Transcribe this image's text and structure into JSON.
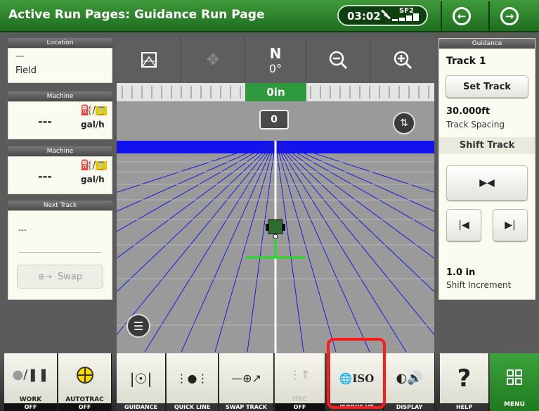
{
  "header": {
    "title": "Active Run Pages: Guidance Run Page",
    "clock": "03:02",
    "signal_label": "SF2"
  },
  "left_panel": {
    "location": {
      "header": "Location",
      "line1": "---",
      "line2": "Field"
    },
    "machine1": {
      "header": "Machine",
      "value": "---",
      "unit": "gal/h"
    },
    "machine2": {
      "header": "Machine",
      "value": "---",
      "unit": "gal/h"
    },
    "next_track": {
      "header": "Next Track",
      "value": "---",
      "swap_label": "Swap"
    }
  },
  "map": {
    "compass_letter": "N",
    "compass_degrees": "0°",
    "offset_ruler": "0in",
    "offset_box": "0"
  },
  "right_panel": {
    "header": "Guidance",
    "track_name": "Track 1",
    "set_track_label": "Set Track",
    "track_spacing_value": "30.000ft",
    "track_spacing_label": "Track Spacing",
    "shift_track_label": "Shift Track",
    "shift_increment_value": "1.0 in",
    "shift_increment_label": "Shift Increment"
  },
  "bottom_bar": {
    "work": {
      "label": "WORK",
      "status": "OFF"
    },
    "autotrac": {
      "label": "AUTOTRAC",
      "status": "OFF"
    },
    "guidance": "GUIDANCE",
    "quick_line": "QUICK LINE",
    "swap_track": "SWAP TRACK",
    "itec": {
      "label": "iTEC",
      "status": "OFF"
    },
    "isobus": {
      "label": "ISOBUS VT",
      "icon_text": "ISO"
    },
    "display": "DISPLAY",
    "help": "HELP",
    "menu": "MENU"
  },
  "colors": {
    "header_green": "#2e8a2e",
    "highlight_red": "#ff1a1a",
    "guidance_line": "#1010dd",
    "ruler_green": "#2f9a3d"
  }
}
